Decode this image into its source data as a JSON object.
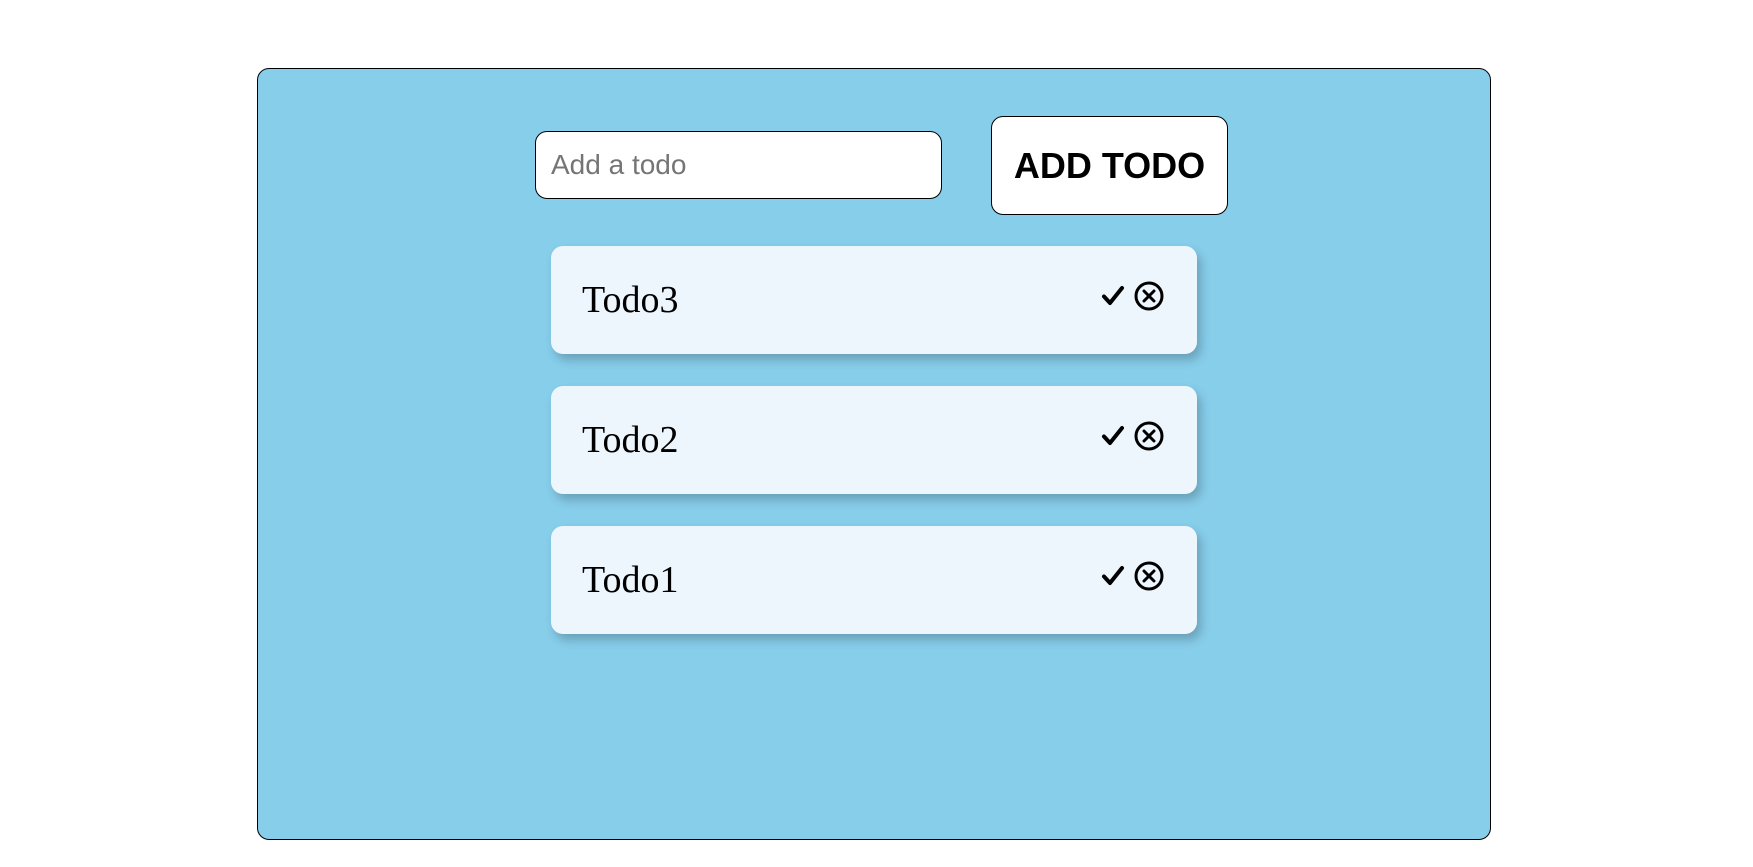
{
  "input": {
    "placeholder": "Add a todo",
    "value": ""
  },
  "add_button": {
    "label": "ADD TODO"
  },
  "todos": [
    {
      "text": "Todo3",
      "complete_icon": "check-icon",
      "delete_icon": "close-circle-icon"
    },
    {
      "text": "Todo2",
      "complete_icon": "check-icon",
      "delete_icon": "close-circle-icon"
    },
    {
      "text": "Todo1",
      "complete_icon": "check-icon",
      "delete_icon": "close-circle-icon"
    }
  ],
  "colors": {
    "panel_background": "#87ceeb",
    "item_background": "#eef6fd",
    "page_background": "#ffffff"
  }
}
